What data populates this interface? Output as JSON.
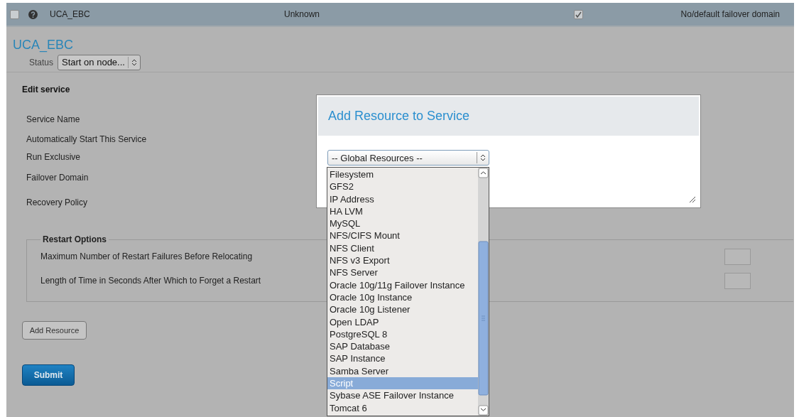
{
  "service_row": {
    "checked": false,
    "name": "UCA_EBC",
    "status": "Unknown",
    "autostart": true,
    "failover": "No/default failover domain"
  },
  "service": {
    "title": "UCA_EBC",
    "status_label": "Status",
    "status_value": "Start on node..."
  },
  "edit_service": {
    "heading": "Edit service",
    "labels": [
      "Service Name",
      "Automatically Start This Service",
      "Run Exclusive",
      "Failover Domain",
      "Recovery Policy"
    ]
  },
  "restart_options": {
    "legend": "Restart Options",
    "fields": [
      "Maximum Number of Restart Failures Before Relocating",
      "Length of Time in Seconds After Which to Forget a Restart"
    ]
  },
  "buttons": {
    "add_resource": "Add Resource",
    "submit": "Submit"
  },
  "dialog": {
    "title": "Add Resource to Service",
    "select_value": "-- Global Resources --",
    "options": [
      {
        "label": "Filesystem",
        "selected": false
      },
      {
        "label": "GFS2",
        "selected": false
      },
      {
        "label": "IP Address",
        "selected": false
      },
      {
        "label": "HA LVM",
        "selected": false
      },
      {
        "label": "MySQL",
        "selected": false
      },
      {
        "label": "NFS/CIFS Mount",
        "selected": false
      },
      {
        "label": "NFS Client",
        "selected": false
      },
      {
        "label": "NFS v3 Export",
        "selected": false
      },
      {
        "label": "NFS Server",
        "selected": false
      },
      {
        "label": "Oracle 10g/11g Failover Instance",
        "selected": false
      },
      {
        "label": "Oracle 10g Instance",
        "selected": false
      },
      {
        "label": "Oracle 10g Listener",
        "selected": false
      },
      {
        "label": "Open LDAP",
        "selected": false
      },
      {
        "label": "PostgreSQL 8",
        "selected": false
      },
      {
        "label": "SAP Database",
        "selected": false
      },
      {
        "label": "SAP Instance",
        "selected": false
      },
      {
        "label": "Samba Server",
        "selected": false
      },
      {
        "label": "Script",
        "selected": true
      },
      {
        "label": "Sybase ASE Failover Instance",
        "selected": false
      },
      {
        "label": "Tomcat 6",
        "selected": false
      }
    ]
  }
}
